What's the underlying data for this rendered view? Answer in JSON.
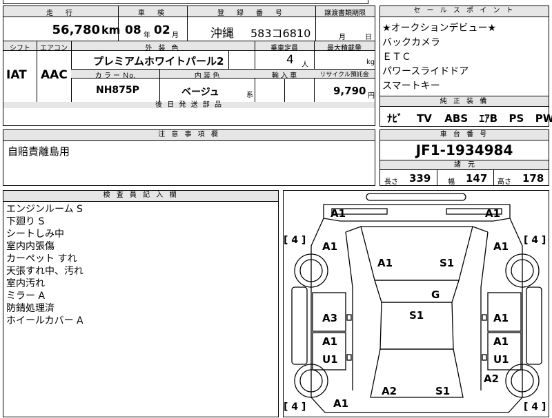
{
  "top_info": {
    "headers": {
      "mileage": "走　行",
      "inspection": "車　検",
      "registration": "登　録　番　号",
      "transfer_deadline": "譲渡書類期限"
    },
    "mileage_value": "56,780",
    "mileage_unit": "km",
    "inspection_year": "08",
    "inspection_year_unit": "年",
    "inspection_month": "02",
    "inspection_month_unit": "月",
    "reg_region": "沖縄",
    "reg_number": "583コ6810",
    "deadline_month_unit": "月",
    "deadline_day_unit": "日"
  },
  "mid_info": {
    "headers": {
      "shift": "シフト",
      "aircon": "エアコン",
      "exterior_color": "外 装 色",
      "capacity": "乗車定員",
      "max_load": "最大積載量",
      "color_no": "カ ラ ー Ｎo.",
      "interior_color": "内 装 色",
      "import": "輸 入 車",
      "recycle": "リサイクル預託金"
    },
    "shift": "IAT",
    "aircon": "AAC",
    "exterior_color": "プレミアムホワイトパール2",
    "capacity": "4",
    "capacity_unit": "人",
    "max_load_unit": "kg",
    "color_no": "NH875P",
    "interior_color": "ベージュ",
    "interior_suffix": "系",
    "recycle_value": "9,790",
    "recycle_unit": "円"
  },
  "later_parts": {
    "header": "後 日 発 送 部 品"
  },
  "notes": {
    "header": "注 意 事 項 欄",
    "text": "自賠責離島用"
  },
  "sales_points": {
    "header": "セ ー ル ス ポ イ ン ト",
    "items": [
      "★オークションデビュー★",
      "バックカメラ",
      "ＥＴＣ",
      "パワースライドドア",
      "スマートキー"
    ]
  },
  "equipment": {
    "header": "純 正 装 備",
    "items": [
      "ﾅﾋﾞ",
      "TV",
      "ABS",
      "ｴｱB",
      "PS",
      "PW"
    ]
  },
  "chassis": {
    "header": "車 台 番 号",
    "value": "JF1-1934984"
  },
  "dimensions": {
    "header": "諸　元",
    "length_label": "長さ",
    "length": "339",
    "width_label": "幅",
    "width": "147",
    "height_label": "高さ",
    "height": "178"
  },
  "inspector": {
    "header": "検 査 員 記 入 欄",
    "lines": [
      "エンジンルーム S",
      "下廻り S",
      "シートしみ中",
      "室内内張傷",
      "カーペット すれ",
      "天張すれ中、汚れ",
      "室内汚れ",
      "ミラー A",
      "防錆処理済",
      "ホイールカバー A"
    ]
  },
  "diagram": {
    "tire_brackets": [
      "[ 4 ]",
      "[ 4 ]",
      "[ 4 ]",
      "[ 4 ]"
    ],
    "labels": [
      "A1",
      "A1",
      "A1",
      "A1",
      "A1",
      "S1",
      "G",
      "S1",
      "A3",
      "A1",
      "A1",
      "A1",
      "U1",
      "U1",
      "A2",
      "A2",
      "S1",
      "A1"
    ]
  }
}
